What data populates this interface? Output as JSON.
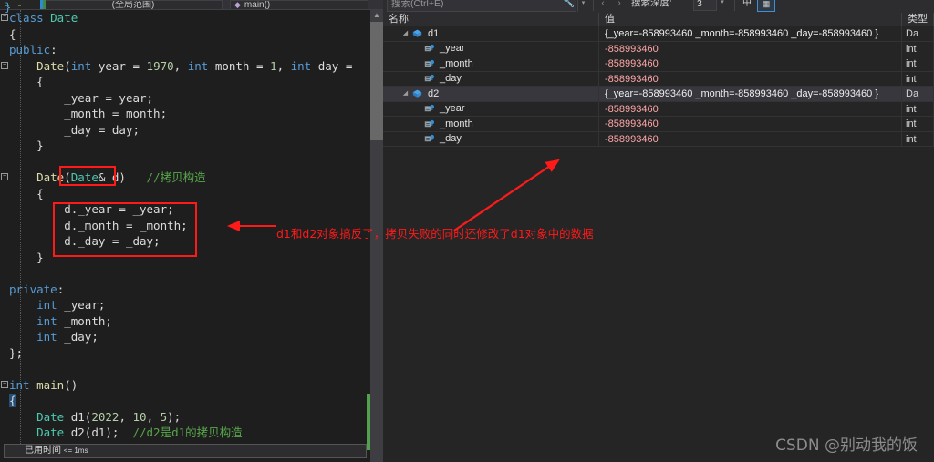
{
  "editor": {
    "nav": {
      "scope_label": "(全局范围)",
      "function_label": "main()",
      "function_icon": "method-icon"
    },
    "code_lines": [
      {
        "id": "l1",
        "tokens": [
          {
            "t": "class ",
            "c": "kw"
          },
          {
            "t": "Date",
            "c": "typ"
          }
        ],
        "indent": 0,
        "expander": "minus"
      },
      {
        "id": "l2",
        "tokens": [
          {
            "t": "{",
            "c": "br"
          }
        ],
        "indent": 0
      },
      {
        "id": "l3",
        "tokens": [
          {
            "t": "public",
            "c": "kw"
          },
          {
            "t": ":",
            "c": "pl"
          }
        ],
        "indent": 0
      },
      {
        "id": "l4",
        "tokens": [
          {
            "t": "Date",
            "c": "fn"
          },
          {
            "t": "(",
            "c": "pl"
          },
          {
            "t": "int",
            "c": "kw"
          },
          {
            "t": " year = ",
            "c": "pl"
          },
          {
            "t": "1970",
            "c": "num"
          },
          {
            "t": ", ",
            "c": "pl"
          },
          {
            "t": "int",
            "c": "kw"
          },
          {
            "t": " month = ",
            "c": "pl"
          },
          {
            "t": "1",
            "c": "num"
          },
          {
            "t": ", ",
            "c": "pl"
          },
          {
            "t": "int",
            "c": "kw"
          },
          {
            "t": " day =",
            "c": "pl"
          }
        ],
        "indent": 1,
        "expander": "minus"
      },
      {
        "id": "l5",
        "tokens": [
          {
            "t": "{",
            "c": "br"
          }
        ],
        "indent": 1
      },
      {
        "id": "l6",
        "tokens": [
          {
            "t": "_year = year;",
            "c": "pl"
          }
        ],
        "indent": 2
      },
      {
        "id": "l7",
        "tokens": [
          {
            "t": "_month = month;",
            "c": "pl"
          }
        ],
        "indent": 2
      },
      {
        "id": "l8",
        "tokens": [
          {
            "t": "_day = day;",
            "c": "pl"
          }
        ],
        "indent": 2
      },
      {
        "id": "l9",
        "tokens": [
          {
            "t": "}",
            "c": "br"
          }
        ],
        "indent": 1
      },
      {
        "id": "l10",
        "tokens": [],
        "indent": 0
      },
      {
        "id": "l11",
        "tokens": [
          {
            "t": "Date",
            "c": "fn"
          },
          {
            "t": "(",
            "c": "pl"
          },
          {
            "t": "Date",
            "c": "typ"
          },
          {
            "t": "& d)",
            "c": "pl"
          },
          {
            "t": "   ",
            "c": "pl"
          },
          {
            "t": "//拷贝构造",
            "c": "cmt"
          }
        ],
        "indent": 1,
        "expander": "minus"
      },
      {
        "id": "l12",
        "tokens": [
          {
            "t": "{",
            "c": "br"
          }
        ],
        "indent": 1
      },
      {
        "id": "l13",
        "tokens": [
          {
            "t": "d._year = _year;",
            "c": "pl"
          }
        ],
        "indent": 2
      },
      {
        "id": "l14",
        "tokens": [
          {
            "t": "d._month = _month;",
            "c": "pl"
          }
        ],
        "indent": 2
      },
      {
        "id": "l15",
        "tokens": [
          {
            "t": "d._day = _day;",
            "c": "pl"
          }
        ],
        "indent": 2
      },
      {
        "id": "l16",
        "tokens": [
          {
            "t": "}",
            "c": "br"
          }
        ],
        "indent": 1
      },
      {
        "id": "l17",
        "tokens": [],
        "indent": 0
      },
      {
        "id": "l18",
        "tokens": [
          {
            "t": "private",
            "c": "kw"
          },
          {
            "t": ":",
            "c": "pl"
          }
        ],
        "indent": 0
      },
      {
        "id": "l19",
        "tokens": [
          {
            "t": "int",
            "c": "kw"
          },
          {
            "t": " _year;",
            "c": "pl"
          }
        ],
        "indent": 1
      },
      {
        "id": "l20",
        "tokens": [
          {
            "t": "int",
            "c": "kw"
          },
          {
            "t": " _month;",
            "c": "pl"
          }
        ],
        "indent": 1
      },
      {
        "id": "l21",
        "tokens": [
          {
            "t": "int",
            "c": "kw"
          },
          {
            "t": " _day;",
            "c": "pl"
          }
        ],
        "indent": 1
      },
      {
        "id": "l22",
        "tokens": [
          {
            "t": "};",
            "c": "br"
          }
        ],
        "indent": 0
      },
      {
        "id": "l23",
        "tokens": [],
        "indent": 0
      },
      {
        "id": "l24",
        "tokens": [
          {
            "t": "int",
            "c": "kw"
          },
          {
            "t": " ",
            "c": "pl"
          },
          {
            "t": "main",
            "c": "fn"
          },
          {
            "t": "()",
            "c": "pl"
          }
        ],
        "indent": 0,
        "expander": "minus"
      },
      {
        "id": "l25",
        "tokens": [
          {
            "t": "{",
            "c": "caretbox"
          }
        ],
        "indent": 0
      },
      {
        "id": "l26",
        "tokens": [
          {
            "t": "Date",
            "c": "typ"
          },
          {
            "t": " d1(",
            "c": "pl"
          },
          {
            "t": "2022",
            "c": "num"
          },
          {
            "t": ", ",
            "c": "pl"
          },
          {
            "t": "10",
            "c": "num"
          },
          {
            "t": ", ",
            "c": "pl"
          },
          {
            "t": "5",
            "c": "num"
          },
          {
            "t": ");",
            "c": "pl"
          }
        ],
        "indent": 1
      },
      {
        "id": "l27",
        "tokens": [
          {
            "t": "Date",
            "c": "typ"
          },
          {
            "t": " d2(d1);  ",
            "c": "pl"
          },
          {
            "t": "//d2是d1的拷贝构造",
            "c": "cmt"
          }
        ],
        "indent": 1
      }
    ],
    "status_bar": {
      "brace": "}",
      "text": "已用时间",
      "suffix": "<= 1ms"
    },
    "annotation": {
      "text": "d1和d2对象搞反了，拷贝失败的同时还修改了d1对象中的数据",
      "color": "#ff1a1a",
      "arrow_icon": "left-arrow-icon"
    },
    "highlight_boxes": [
      {
        "name": "param-highlight",
        "label": "Date& d"
      },
      {
        "name": "body-highlight",
        "label": "d._year = _year; d._month = _month; d._day = _day;"
      }
    ],
    "scrollbar": {
      "up_icon": "chevron-up-icon",
      "down_icon": "chevron-down-icon"
    }
  },
  "watch": {
    "toolbar": {
      "search_placeholder": "搜索(Ctrl+E)",
      "search_value": "",
      "search_icon": "search-wrench-icon",
      "search_dropdown_icon": "chevron-down-icon",
      "prev_icon": "chevron-left-icon",
      "next_icon": "chevron-right-icon",
      "depth_label": "搜索深度:",
      "depth_value": "3",
      "depth_dropdown_icon": "chevron-down-icon",
      "lang_button_label": "中",
      "grid_button_icon": "grid-icon"
    },
    "columns": [
      "名称",
      "值",
      "类型"
    ],
    "rows": [
      {
        "level": 0,
        "expander": "expanded",
        "icon": "object-icon",
        "name": "d1",
        "value": "{_year=-858993460 _month=-858993460 _day=-858993460 }",
        "value_style": "white",
        "type": "Da",
        "selected": false
      },
      {
        "level": 1,
        "expander": "none",
        "icon": "field-icon",
        "name": "_year",
        "value": "-858993460",
        "value_style": "red",
        "type": "int",
        "selected": false
      },
      {
        "level": 1,
        "expander": "none",
        "icon": "field-icon",
        "name": "_month",
        "value": "-858993460",
        "value_style": "red",
        "type": "int",
        "selected": false
      },
      {
        "level": 1,
        "expander": "none",
        "icon": "field-icon",
        "name": "_day",
        "value": "-858993460",
        "value_style": "red",
        "type": "int",
        "selected": false
      },
      {
        "level": 0,
        "expander": "expanded",
        "icon": "object-icon",
        "name": "d2",
        "value": "{_year=-858993460 _month=-858993460 _day=-858993460 }",
        "value_style": "white",
        "type": "Da",
        "selected": true
      },
      {
        "level": 1,
        "expander": "none",
        "icon": "field-icon",
        "name": "_year",
        "value": "-858993460",
        "value_style": "red",
        "type": "int",
        "selected": false
      },
      {
        "level": 1,
        "expander": "none",
        "icon": "field-icon",
        "name": "_month",
        "value": "-858993460",
        "value_style": "red",
        "type": "int",
        "selected": false
      },
      {
        "level": 1,
        "expander": "none",
        "icon": "field-icon",
        "name": "_day",
        "value": "-858993460",
        "value_style": "red",
        "type": "int",
        "selected": false
      }
    ],
    "highlight_box": {
      "name": "value-column-highlight",
      "color": "#ff1a1a"
    },
    "arrow": {
      "name": "pointer-arrow",
      "color": "#ff1a1a"
    }
  },
  "watermark": {
    "text": "CSDN @别动我的饭"
  },
  "colors": {
    "annotation_red": "#ff1a1a",
    "editor_bg": "#1e1e1e",
    "panel_bg": "#252526",
    "selected_row": "#37373d",
    "keyword": "#569cd6",
    "type": "#4ec9b0",
    "comment": "#57a64a",
    "number": "#b5cea8",
    "function": "#dcdcaa",
    "value_red": "#ffa6a6"
  }
}
